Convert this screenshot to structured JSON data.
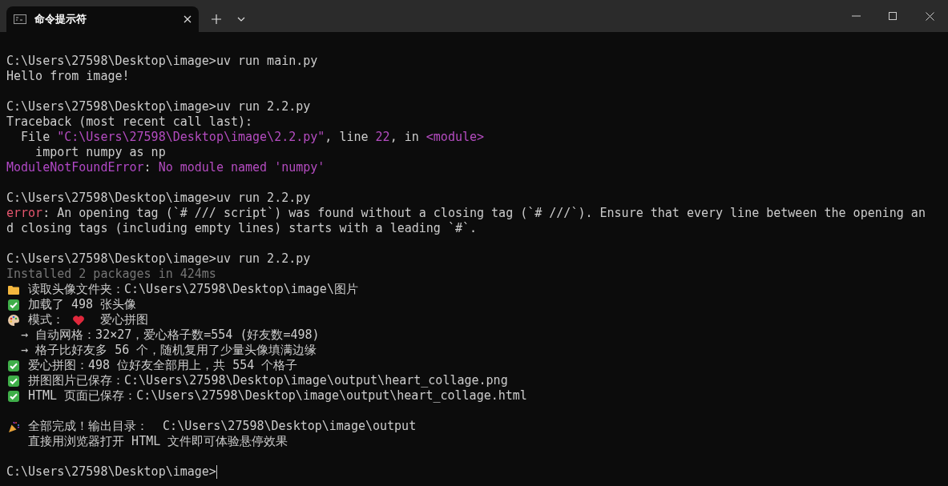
{
  "tab": {
    "title": "命令提示符",
    "selected": true
  },
  "output_blocks": [
    {
      "lines": [
        {
          "segments": [
            {
              "kind": "text",
              "text": "C:\\Users\\27598\\Desktop\\image>uv run main.py"
            }
          ]
        },
        {
          "segments": [
            {
              "kind": "text",
              "text": "Hello from image!"
            }
          ]
        }
      ]
    },
    {
      "lines": [
        {
          "segments": [
            {
              "kind": "text",
              "text": "C:\\Users\\27598\\Desktop\\image>uv run 2.2.py"
            }
          ]
        },
        {
          "segments": [
            {
              "kind": "text",
              "text": "Traceback (most recent call last):"
            }
          ]
        },
        {
          "segments": [
            {
              "kind": "text",
              "text": "  File "
            },
            {
              "kind": "accent",
              "text": "\"C:\\Users\\27598\\Desktop\\image\\2.2.py\""
            },
            {
              "kind": "text",
              "text": ", line "
            },
            {
              "kind": "accent",
              "text": "22"
            },
            {
              "kind": "text",
              "text": ", in "
            },
            {
              "kind": "accent",
              "text": "<module>"
            }
          ]
        },
        {
          "segments": [
            {
              "kind": "text",
              "text": "    import numpy as np"
            }
          ]
        },
        {
          "segments": [
            {
              "kind": "exception",
              "text": "ModuleNotFoundError"
            },
            {
              "kind": "text",
              "text": ": "
            },
            {
              "kind": "accent",
              "text": "No module named 'numpy'"
            }
          ]
        }
      ]
    },
    {
      "lines": [
        {
          "segments": [
            {
              "kind": "text",
              "text": "C:\\Users\\27598\\Desktop\\image>uv run 2.2.py"
            }
          ]
        },
        {
          "segments": [
            {
              "kind": "error",
              "text": "error"
            },
            {
              "kind": "text",
              "text": ": An opening tag (`# /// script`) was found without a closing tag (`# ///`). Ensure that every line between the opening an"
            }
          ]
        },
        {
          "segments": [
            {
              "kind": "text",
              "text": "d closing tags (including empty lines) starts with a leading `#`."
            }
          ]
        }
      ]
    },
    {
      "lines": [
        {
          "segments": [
            {
              "kind": "text",
              "text": "C:\\Users\\27598\\Desktop\\image>uv run 2.2.py"
            }
          ]
        },
        {
          "segments": [
            {
              "kind": "dim",
              "text": "Installed 2 packages in 424ms"
            }
          ]
        },
        {
          "segments": [
            {
              "kind": "folder"
            },
            {
              "kind": "text",
              "text": " 读取头像文件夹：C:\\Users\\27598\\Desktop\\image\\图片"
            }
          ]
        },
        {
          "segments": [
            {
              "kind": "check"
            },
            {
              "kind": "text",
              "text": " 加载了 498 张头像"
            }
          ]
        },
        {
          "segments": [
            {
              "kind": "palette"
            },
            {
              "kind": "text",
              "text": " 模式： "
            },
            {
              "kind": "heart"
            },
            {
              "kind": "text",
              "text": "  爱心拼图"
            }
          ]
        },
        {
          "segments": [
            {
              "kind": "text",
              "text": "  → 自动网格：32×27，爱心格子数=554 (好友数=498)"
            }
          ]
        },
        {
          "segments": [
            {
              "kind": "text",
              "text": "  → 格子比好友多 56 个，随机复用了少量头像填满边缘"
            }
          ]
        },
        {
          "segments": [
            {
              "kind": "check"
            },
            {
              "kind": "text",
              "text": " 爱心拼图：498 位好友全部用上，共 554 个格子"
            }
          ]
        },
        {
          "segments": [
            {
              "kind": "check"
            },
            {
              "kind": "text",
              "text": " 拼图图片已保存：C:\\Users\\27598\\Desktop\\image\\output\\heart_collage.png"
            }
          ]
        },
        {
          "segments": [
            {
              "kind": "check"
            },
            {
              "kind": "text",
              "text": " HTML 页面已保存：C:\\Users\\27598\\Desktop\\image\\output\\heart_collage.html"
            }
          ]
        }
      ]
    },
    {
      "lines": [
        {
          "segments": [
            {
              "kind": "party"
            },
            {
              "kind": "text",
              "text": " 全部完成！输出目录：  C:\\Users\\27598\\Desktop\\image\\output"
            }
          ]
        },
        {
          "segments": [
            {
              "kind": "text",
              "text": "   直接用浏览器打开 HTML 文件即可体验悬停效果"
            }
          ]
        }
      ]
    },
    {
      "lines": [
        {
          "segments": [
            {
              "kind": "text",
              "text": "C:\\Users\\27598\\Desktop\\image>"
            },
            {
              "kind": "cursor"
            }
          ]
        }
      ]
    }
  ]
}
